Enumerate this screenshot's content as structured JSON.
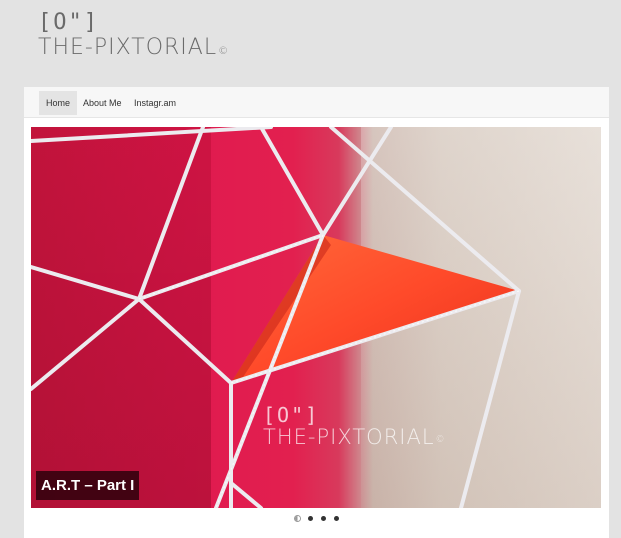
{
  "logo": {
    "mark": "[O\"]",
    "text": "THE-PIXTORIAL",
    "copyright_symbol": "©"
  },
  "nav": {
    "items": [
      {
        "label": "Home",
        "active": true
      },
      {
        "label": "About Me",
        "active": false
      },
      {
        "label": "Instagr.am",
        "active": false
      }
    ]
  },
  "slider": {
    "caption": "A.R.T – Part I",
    "watermark": {
      "mark": "[O\"]",
      "text": "THE-PIXTORIAL",
      "copyright_symbol": "©"
    },
    "slide_count": 4,
    "active_index": 0
  },
  "colors": {
    "background": "#e3e3e3",
    "panel": "#ffffff",
    "accent_red": "#e01a4f",
    "caption_bg": "#28000a"
  }
}
